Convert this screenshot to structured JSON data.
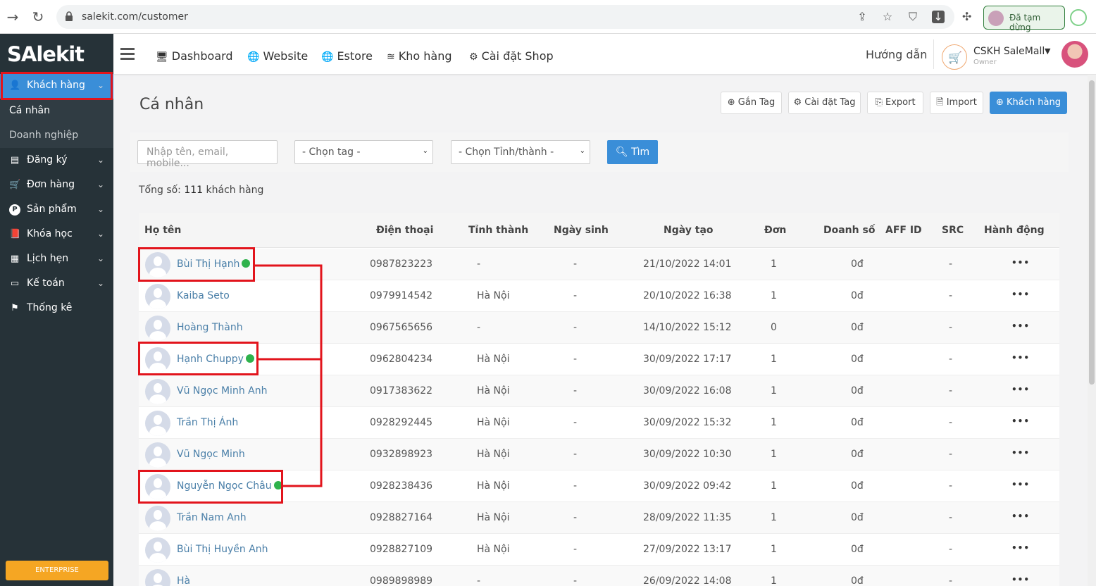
{
  "browser": {
    "url": "salekit.com/customer",
    "profile_status": "Đã tạm dừng"
  },
  "sidebar": {
    "logo": "SAlekit",
    "active_item": "Khách hàng",
    "sub_items": [
      "Cá nhân",
      "Doanh nghiệp"
    ],
    "items": [
      {
        "label": "Đăng ký",
        "icon": "list-icon"
      },
      {
        "label": "Đơn hàng",
        "icon": "cart-icon"
      },
      {
        "label": "Sản phẩm",
        "icon": "product-icon"
      },
      {
        "label": "Khóa học",
        "icon": "book-icon"
      },
      {
        "label": "Lịch hẹn",
        "icon": "calendar-icon"
      },
      {
        "label": "Kế toán",
        "icon": "card-icon"
      },
      {
        "label": "Thống kê",
        "icon": "flag-icon"
      }
    ],
    "badge": "ENTERPRISE"
  },
  "topnav": {
    "items": [
      "Dashboard",
      "Website",
      "Estore",
      "Kho hàng",
      "Cài đặt Shop"
    ],
    "guide": "Hướng dẫn",
    "account_name": "CSKH SaleMall",
    "account_role": "Owner"
  },
  "page": {
    "title": "Cá nhân",
    "actions": [
      "Gắn Tag",
      "Cài đặt Tag",
      "Export",
      "Import",
      "Khách hàng"
    ]
  },
  "filters": {
    "search_placeholder": "Nhập tên, email, mobile...",
    "tag_select": "- Chọn tag -",
    "province_select": "- Chọn Tỉnh/thành -",
    "search_button": "Tìm"
  },
  "summary": {
    "prefix": "Tổng số:",
    "count": "111",
    "suffix": "khách hàng"
  },
  "table": {
    "columns": [
      "Họ tên",
      "Điện thoại",
      "Tỉnh thành",
      "Ngày sinh",
      "Ngày tạo",
      "Đơn",
      "Doanh số",
      "AFF ID",
      "SRC",
      "Hành động"
    ],
    "rows": [
      {
        "name": "Bùi Thị Hạnh",
        "messenger": true,
        "phone": "0987823223",
        "province": "-",
        "birthday": "-",
        "created": "21/10/2022 14:01",
        "orders": "1",
        "revenue": "0đ",
        "aff": "",
        "src": "-",
        "action": "•••"
      },
      {
        "name": "Kaiba Seto",
        "messenger": false,
        "phone": "0979914542",
        "province": "Hà Nội",
        "birthday": "-",
        "created": "20/10/2022 16:38",
        "orders": "1",
        "revenue": "0đ",
        "aff": "",
        "src": "-",
        "action": "•••"
      },
      {
        "name": "Hoàng Thành",
        "messenger": false,
        "phone": "0967565656",
        "province": "-",
        "birthday": "-",
        "created": "14/10/2022 15:12",
        "orders": "0",
        "revenue": "0đ",
        "aff": "",
        "src": "-",
        "action": "•••"
      },
      {
        "name": "Hạnh Chuppy",
        "messenger": true,
        "phone": "0962804234",
        "province": "Hà Nội",
        "birthday": "-",
        "created": "30/09/2022 17:17",
        "orders": "1",
        "revenue": "0đ",
        "aff": "",
        "src": "-",
        "action": "•••"
      },
      {
        "name": "Vũ Ngọc Minh Anh",
        "messenger": false,
        "phone": "0917383622",
        "province": "Hà Nội",
        "birthday": "-",
        "created": "30/09/2022 16:08",
        "orders": "1",
        "revenue": "0đ",
        "aff": "",
        "src": "-",
        "action": "•••"
      },
      {
        "name": "Trần Thị Ánh",
        "messenger": false,
        "phone": "0928292445",
        "province": "Hà Nội",
        "birthday": "-",
        "created": "30/09/2022 15:32",
        "orders": "1",
        "revenue": "0đ",
        "aff": "",
        "src": "-",
        "action": "•••"
      },
      {
        "name": "Vũ Ngọc Minh",
        "messenger": false,
        "phone": "0932898923",
        "province": "Hà Nội",
        "birthday": "-",
        "created": "30/09/2022 10:30",
        "orders": "1",
        "revenue": "0đ",
        "aff": "",
        "src": "-",
        "action": "•••"
      },
      {
        "name": "Nguyễn Ngọc Châu",
        "messenger": true,
        "phone": "0928238436",
        "province": "Hà Nội",
        "birthday": "-",
        "created": "30/09/2022 09:42",
        "orders": "1",
        "revenue": "0đ",
        "aff": "",
        "src": "-",
        "action": "•••"
      },
      {
        "name": "Trần Nam Anh",
        "messenger": false,
        "phone": "0928827164",
        "province": "Hà Nội",
        "birthday": "-",
        "created": "28/09/2022 11:35",
        "orders": "1",
        "revenue": "0đ",
        "aff": "",
        "src": "-",
        "action": "•••"
      },
      {
        "name": "Bùi Thị Huyền Anh",
        "messenger": false,
        "phone": "0928827109",
        "province": "Hà Nội",
        "birthday": "-",
        "created": "27/09/2022 13:17",
        "orders": "1",
        "revenue": "0đ",
        "aff": "",
        "src": "-",
        "action": "•••"
      },
      {
        "name": "Hà",
        "messenger": false,
        "phone": "0989898989",
        "province": "-",
        "birthday": "-",
        "created": "26/09/2022 14:08",
        "orders": "1",
        "revenue": "0đ",
        "aff": "",
        "src": "-",
        "action": "•••"
      }
    ]
  },
  "colors": {
    "accent": "#3a8ed8",
    "sidebar_bg": "#263238",
    "highlight": "#e2141c",
    "messenger": "#2fb24c",
    "enterprise": "#f5a623"
  }
}
